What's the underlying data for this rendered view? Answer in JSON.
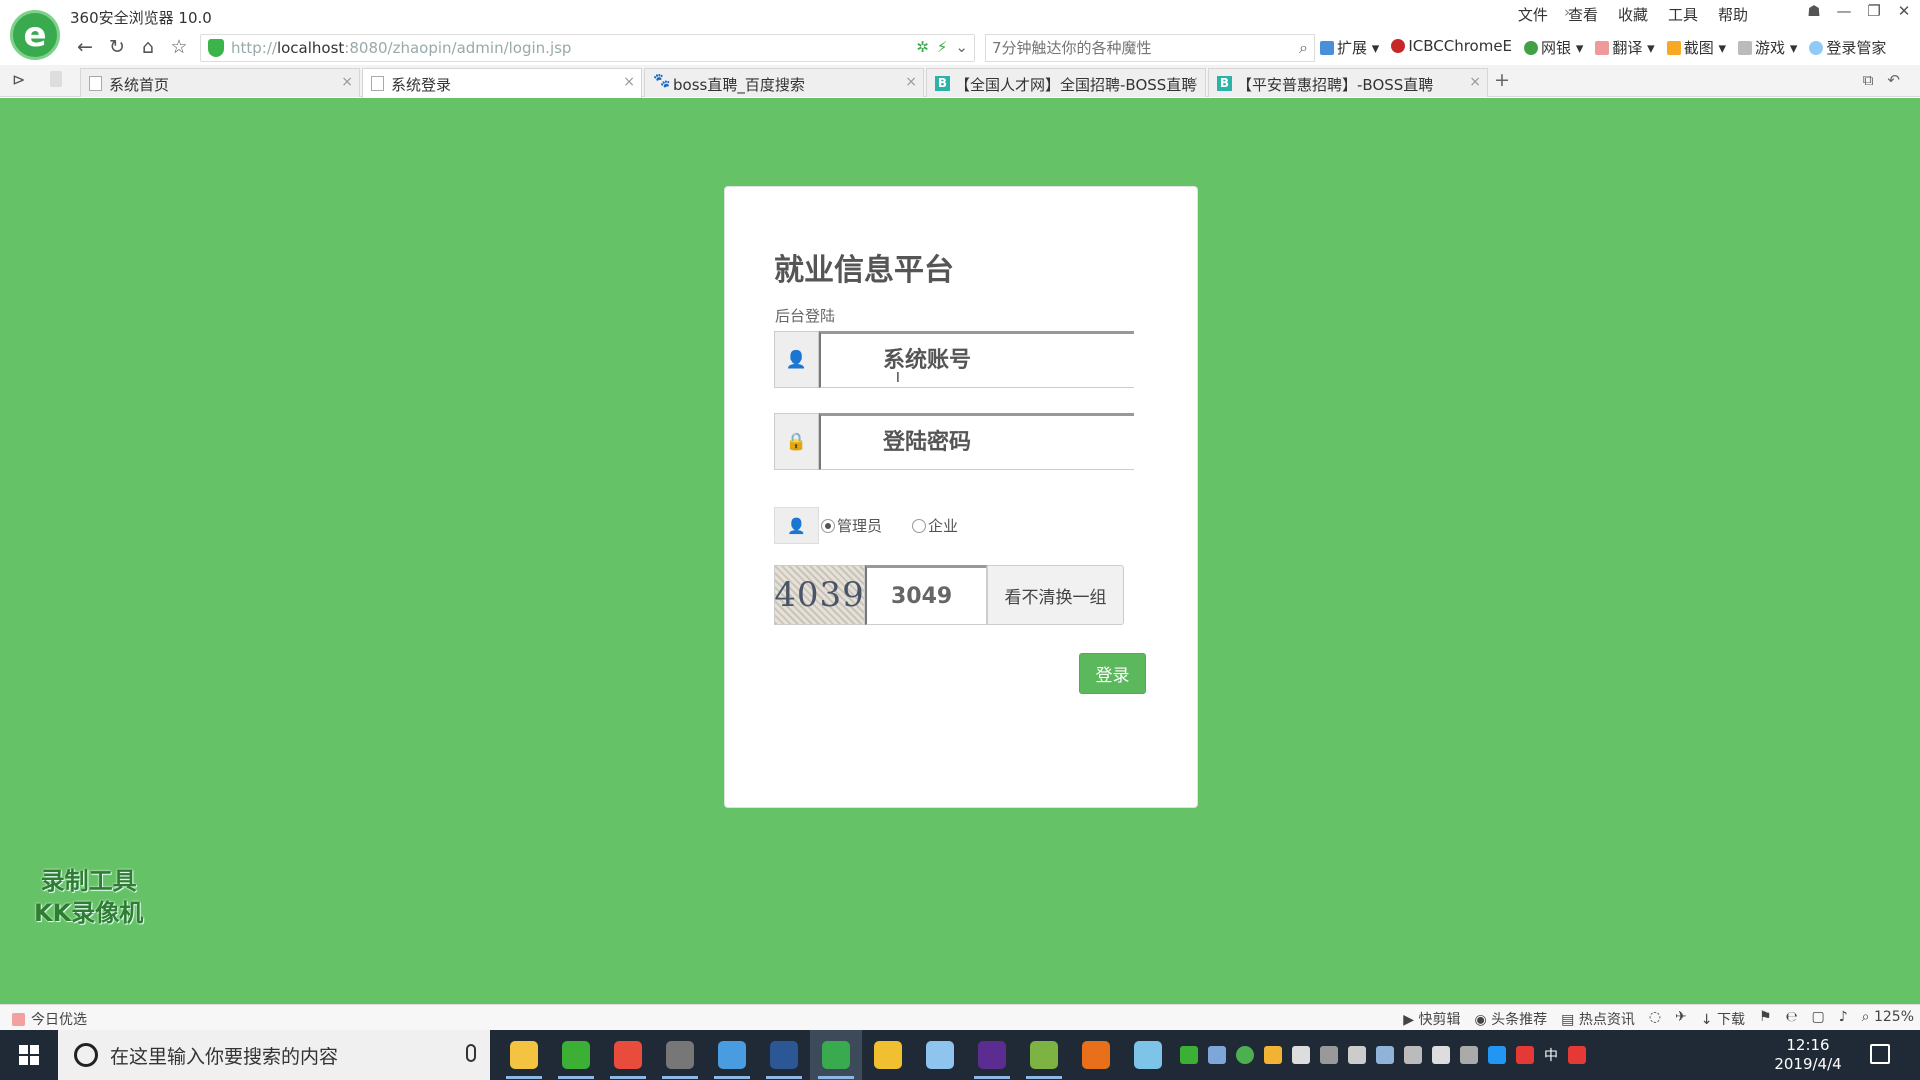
{
  "browser": {
    "app_title": "360安全浏览器 10.0",
    "top_menu": [
      "文件",
      "查看",
      "收藏",
      "工具",
      "帮助"
    ],
    "url_host": "localhost",
    "url_prefix": "http://",
    "url_rest": ":8080/zhaopin/admin/login.jsp",
    "search_placeholder": "7分钟触达你的各种魔性",
    "extensions": [
      "扩展",
      "ICBCChromeE",
      "网银",
      "翻译",
      "截图",
      "游戏",
      "登录管家"
    ],
    "tabs": [
      {
        "label": "系统首页",
        "active": false
      },
      {
        "label": "系统登录",
        "active": true
      },
      {
        "label": "boss直聘_百度搜索",
        "active": false
      },
      {
        "label": "【全国人才网】全国招聘-BOSS直聘",
        "active": false
      },
      {
        "label": "【平安普惠招聘】-BOSS直聘",
        "active": false
      }
    ],
    "new_tab_symbol": "+"
  },
  "login": {
    "title": "就业信息平台",
    "subtitle": "后台登陆",
    "account_placeholder": "系统账号",
    "password_placeholder": "登陆密码",
    "roles": [
      {
        "label": "管理员",
        "checked": true
      },
      {
        "label": "企业",
        "checked": false
      }
    ],
    "captcha_image_text": "4039",
    "captcha_value": "3049",
    "refresh_label": "看不清换一组",
    "submit_label": "登录"
  },
  "watermark": {
    "line1": "录制工具",
    "line2": "KK录像机"
  },
  "statusbar": {
    "left": "今日优选",
    "right": [
      "快剪辑",
      "头条推荐",
      "热点资讯",
      "下载",
      "125%"
    ]
  },
  "taskbar": {
    "search_placeholder": "在这里输入你要搜索的内容",
    "time": "12:16",
    "date": "2019/4/4",
    "ime": "中",
    "apps": [
      {
        "name": "file-explorer",
        "color": "#f5c342",
        "running": true
      },
      {
        "name": "wechat",
        "color": "#3cb034",
        "running": true
      },
      {
        "name": "chrome",
        "color": "#e94b3c",
        "running": true
      },
      {
        "name": "settings",
        "color": "#777777",
        "running": true
      },
      {
        "name": "search-tool",
        "color": "#4a9ce0",
        "running": true
      },
      {
        "name": "word",
        "color": "#2b5797",
        "running": true
      },
      {
        "name": "360-browser",
        "color": "#3aaa4f",
        "running": true,
        "active": true
      },
      {
        "name": "duck-app",
        "color": "#f0c030",
        "running": false
      },
      {
        "name": "globe-app",
        "color": "#8fc4ef",
        "running": false
      },
      {
        "name": "visual-studio",
        "color": "#5c2d91",
        "running": true
      },
      {
        "name": "notepad-plus",
        "color": "#7cb342",
        "running": true
      },
      {
        "name": "tomcat",
        "color": "#e8701a",
        "running": false
      },
      {
        "name": "notes-app",
        "color": "#7ec3e8",
        "running": false
      }
    ]
  }
}
